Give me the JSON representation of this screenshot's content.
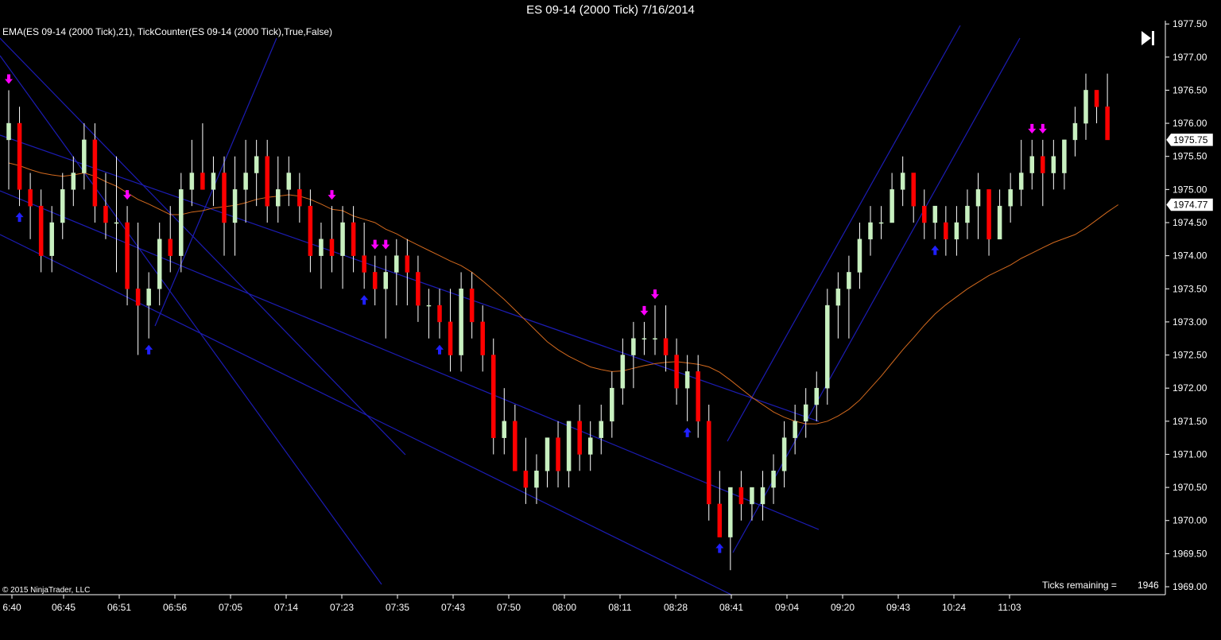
{
  "window": {
    "title": "ES 09-14 (2000 Tick)  7/16/2014"
  },
  "indicator_label": "EMA(ES 09-14 (2000 Tick),21),  TickCounter(ES 09-14 (2000 Tick),True,False)",
  "copyright": "© 2015 NinjaTrader, LLC",
  "ticks_remaining": {
    "label": "Ticks remaining =",
    "value": "1946"
  },
  "icons": {
    "play_to_end": "skip-to-end-icon"
  },
  "colors": {
    "background": "#000000",
    "up_bar": "#c8f0c0",
    "down_bar": "#ff0000",
    "ema": "#d2691e",
    "trendline": "#1c1cb4",
    "sell_arrow": "#ff00ff",
    "buy_arrow": "#2020ff",
    "axis": "#ffffff"
  },
  "chart_data": {
    "type": "candlestick",
    "instrument": "ES 09-14",
    "interval": "2000 Tick",
    "date": "7/16/2014",
    "ylim": [
      1968.88,
      1977.55
    ],
    "y_ticks": [
      "1977.50",
      "1977.00",
      "1976.50",
      "1976.00",
      "1975.50",
      "1975.00",
      "1974.50",
      "1974.00",
      "1973.50",
      "1973.00",
      "1972.50",
      "1972.00",
      "1971.50",
      "1971.00",
      "1970.50",
      "1970.00",
      "1969.50",
      "1969.00"
    ],
    "x_tick_labels": [
      "6:40",
      "06:45",
      "06:51",
      "06:56",
      "07:05",
      "07:14",
      "07:23",
      "07:35",
      "07:43",
      "07:50",
      "08:00",
      "08:11",
      "08:28",
      "08:41",
      "09:04",
      "09:20",
      "09:43",
      "10:24",
      "11:03"
    ],
    "price_markers": {
      "last": "1975.75",
      "ema": "1974.77"
    },
    "ohlc": [
      [
        1975.75,
        1976.5,
        1975.0,
        1976.0
      ],
      [
        1976.0,
        1976.25,
        1974.75,
        1975.0
      ],
      [
        1975.0,
        1975.25,
        1974.25,
        1974.75
      ],
      [
        1974.75,
        1975.0,
        1973.75,
        1974.0
      ],
      [
        1974.0,
        1974.75,
        1973.75,
        1974.5
      ],
      [
        1974.5,
        1975.25,
        1974.25,
        1975.0
      ],
      [
        1975.0,
        1975.5,
        1974.75,
        1975.25
      ],
      [
        1975.25,
        1976.0,
        1975.0,
        1975.75
      ],
      [
        1975.75,
        1976.0,
        1974.5,
        1974.75
      ],
      [
        1974.75,
        1975.25,
        1974.25,
        1974.5
      ],
      [
        1974.5,
        1975.5,
        1973.75,
        1974.5
      ],
      [
        1974.5,
        1974.75,
        1973.25,
        1973.5
      ],
      [
        1973.5,
        1974.5,
        1972.5,
        1973.25
      ],
      [
        1973.25,
        1973.75,
        1972.75,
        1973.5
      ],
      [
        1973.5,
        1974.5,
        1973.25,
        1974.25
      ],
      [
        1974.25,
        1974.75,
        1973.75,
        1974.0
      ],
      [
        1974.0,
        1975.25,
        1973.75,
        1975.0
      ],
      [
        1975.0,
        1975.75,
        1974.75,
        1975.25
      ],
      [
        1975.25,
        1976.0,
        1975.0,
        1975.0
      ],
      [
        1975.0,
        1975.5,
        1974.75,
        1975.25
      ],
      [
        1975.25,
        1975.5,
        1974.0,
        1974.5
      ],
      [
        1974.5,
        1975.5,
        1974.0,
        1975.0
      ],
      [
        1975.0,
        1975.75,
        1974.5,
        1975.25
      ],
      [
        1975.25,
        1975.75,
        1974.75,
        1975.5
      ],
      [
        1975.5,
        1975.75,
        1974.5,
        1974.75
      ],
      [
        1974.75,
        1975.5,
        1974.5,
        1975.0
      ],
      [
        1975.0,
        1975.5,
        1974.75,
        1975.25
      ],
      [
        1975.0,
        1975.25,
        1974.5,
        1974.75
      ],
      [
        1974.75,
        1975.0,
        1973.75,
        1974.0
      ],
      [
        1974.0,
        1974.5,
        1973.5,
        1974.25
      ],
      [
        1974.25,
        1974.75,
        1973.75,
        1974.0
      ],
      [
        1974.0,
        1974.75,
        1973.5,
        1974.5
      ],
      [
        1974.5,
        1974.75,
        1973.75,
        1974.0
      ],
      [
        1974.0,
        1974.5,
        1973.5,
        1973.75
      ],
      [
        1973.75,
        1974.0,
        1973.25,
        1973.5
      ],
      [
        1973.5,
        1974.0,
        1972.75,
        1973.75
      ],
      [
        1973.75,
        1974.25,
        1973.25,
        1974.0
      ],
      [
        1974.0,
        1974.25,
        1973.25,
        1973.75
      ],
      [
        1973.75,
        1974.0,
        1973.0,
        1973.25
      ],
      [
        1973.25,
        1973.5,
        1972.75,
        1973.25
      ],
      [
        1973.25,
        1973.5,
        1972.75,
        1973.0
      ],
      [
        1973.0,
        1973.5,
        1972.25,
        1972.5
      ],
      [
        1972.5,
        1973.75,
        1972.25,
        1973.5
      ],
      [
        1973.5,
        1973.75,
        1972.75,
        1973.0
      ],
      [
        1973.0,
        1973.25,
        1972.25,
        1972.5
      ],
      [
        1972.5,
        1972.75,
        1971.0,
        1971.25
      ],
      [
        1971.25,
        1972.0,
        1971.0,
        1971.5
      ],
      [
        1971.5,
        1971.75,
        1970.75,
        1970.75
      ],
      [
        1970.75,
        1971.25,
        1970.25,
        1970.5
      ],
      [
        1970.5,
        1971.0,
        1970.25,
        1970.75
      ],
      [
        1970.75,
        1971.25,
        1970.5,
        1971.25
      ],
      [
        1971.25,
        1971.5,
        1970.5,
        1970.75
      ],
      [
        1970.75,
        1971.5,
        1970.5,
        1971.5
      ],
      [
        1971.5,
        1971.75,
        1970.75,
        1971.0
      ],
      [
        1971.0,
        1971.5,
        1970.75,
        1971.25
      ],
      [
        1971.25,
        1971.75,
        1971.0,
        1971.5
      ],
      [
        1971.5,
        1972.25,
        1971.25,
        1972.0
      ],
      [
        1972.0,
        1972.75,
        1971.75,
        1972.5
      ],
      [
        1972.5,
        1973.0,
        1972.0,
        1972.75
      ],
      [
        1972.75,
        1973.0,
        1972.5,
        1972.75
      ],
      [
        1972.75,
        1973.25,
        1972.5,
        1972.75
      ],
      [
        1972.75,
        1973.25,
        1972.25,
        1972.5
      ],
      [
        1972.5,
        1972.75,
        1971.75,
        1972.0
      ],
      [
        1972.0,
        1972.5,
        1971.5,
        1972.25
      ],
      [
        1972.25,
        1972.5,
        1971.25,
        1971.5
      ],
      [
        1971.5,
        1971.75,
        1970.0,
        1970.25
      ],
      [
        1970.25,
        1970.75,
        1969.75,
        1969.75
      ],
      [
        1969.75,
        1970.5,
        1969.25,
        1970.5
      ],
      [
        1970.5,
        1970.75,
        1970.0,
        1970.25
      ],
      [
        1970.25,
        1970.5,
        1970.0,
        1970.5
      ],
      [
        1970.25,
        1970.75,
        1970.0,
        1970.5
      ],
      [
        1970.5,
        1971.0,
        1970.25,
        1970.75
      ],
      [
        1970.75,
        1971.5,
        1970.5,
        1971.25
      ],
      [
        1971.25,
        1971.75,
        1971.0,
        1971.5
      ],
      [
        1971.5,
        1972.0,
        1971.25,
        1971.75
      ],
      [
        1971.75,
        1972.25,
        1971.5,
        1972.0
      ],
      [
        1972.0,
        1973.5,
        1971.75,
        1973.25
      ],
      [
        1973.25,
        1973.75,
        1972.75,
        1973.5
      ],
      [
        1973.5,
        1974.0,
        1972.75,
        1973.75
      ],
      [
        1973.75,
        1974.5,
        1973.5,
        1974.25
      ],
      [
        1974.25,
        1974.75,
        1974.0,
        1974.5
      ],
      [
        1974.5,
        1974.75,
        1974.25,
        1974.5
      ],
      [
        1974.5,
        1975.25,
        1974.5,
        1975.0
      ],
      [
        1975.0,
        1975.5,
        1974.75,
        1975.25
      ],
      [
        1975.25,
        1975.25,
        1974.5,
        1974.75
      ],
      [
        1974.75,
        1975.0,
        1974.25,
        1974.5
      ],
      [
        1974.5,
        1974.75,
        1974.25,
        1974.75
      ],
      [
        1974.5,
        1974.75,
        1974.0,
        1974.25
      ],
      [
        1974.25,
        1974.75,
        1974.0,
        1974.5
      ],
      [
        1974.5,
        1975.0,
        1974.25,
        1974.75
      ],
      [
        1974.75,
        1975.25,
        1974.25,
        1975.0
      ],
      [
        1975.0,
        1975.0,
        1974.0,
        1974.25
      ],
      [
        1974.25,
        1975.0,
        1974.25,
        1974.75
      ],
      [
        1974.75,
        1975.25,
        1974.5,
        1975.0
      ],
      [
        1975.0,
        1975.75,
        1974.75,
        1975.25
      ],
      [
        1975.25,
        1975.75,
        1975.0,
        1975.5
      ],
      [
        1975.5,
        1975.75,
        1974.75,
        1975.25
      ],
      [
        1975.25,
        1975.75,
        1975.0,
        1975.5
      ],
      [
        1975.25,
        1975.75,
        1975.0,
        1975.75
      ],
      [
        1975.75,
        1976.25,
        1975.5,
        1976.0
      ],
      [
        1976.0,
        1976.75,
        1975.75,
        1976.5
      ],
      [
        1976.5,
        1976.5,
        1976.0,
        1976.25
      ],
      [
        1976.25,
        1976.75,
        1975.75,
        1975.75
      ]
    ],
    "ema_21": [
      1975.4,
      1975.36,
      1975.3,
      1975.25,
      1975.22,
      1975.2,
      1975.22,
      1975.25,
      1975.2,
      1975.12,
      1975.05,
      1974.95,
      1974.85,
      1974.78,
      1974.7,
      1974.62,
      1974.62,
      1974.66,
      1974.68,
      1974.72,
      1974.74,
      1974.76,
      1974.8,
      1974.85,
      1974.88,
      1974.9,
      1974.92,
      1974.9,
      1974.85,
      1974.78,
      1974.7,
      1974.68,
      1974.6,
      1974.55,
      1974.5,
      1974.4,
      1974.33,
      1974.24,
      1974.16,
      1974.08,
      1974.0,
      1973.92,
      1973.85,
      1973.75,
      1973.62,
      1973.48,
      1973.34,
      1973.18,
      1973.02,
      1972.86,
      1972.7,
      1972.58,
      1972.48,
      1972.4,
      1972.32,
      1972.28,
      1972.25,
      1972.26,
      1972.3,
      1972.34,
      1972.37,
      1972.39,
      1972.4,
      1972.38,
      1972.36,
      1972.32,
      1972.24,
      1972.12,
      1971.99,
      1971.86,
      1971.75,
      1971.64,
      1971.56,
      1971.5,
      1971.46,
      1971.46,
      1971.5,
      1971.58,
      1971.68,
      1971.82,
      1972.0,
      1972.18,
      1972.38,
      1972.58,
      1972.76,
      1972.95,
      1973.12,
      1973.26,
      1973.38,
      1973.5,
      1973.6,
      1973.7,
      1973.78,
      1973.86,
      1973.96,
      1974.04,
      1974.12,
      1974.2,
      1974.26,
      1974.32,
      1974.42,
      1974.54,
      1974.66,
      1974.77
    ],
    "sell_signals": [
      0,
      11,
      30,
      34,
      35,
      59,
      60,
      95,
      96
    ],
    "buy_signals": [
      1,
      13,
      33,
      40,
      63,
      66,
      86
    ]
  }
}
